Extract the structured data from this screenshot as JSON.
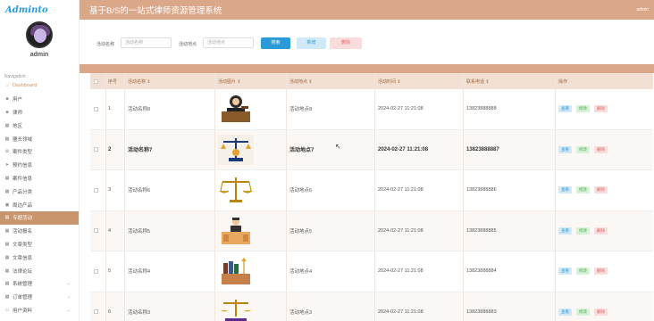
{
  "logo": "Adminto",
  "user": {
    "name": "admin"
  },
  "header": {
    "title": "基于B/S的一站式律师资源管理系统",
    "user": "admin"
  },
  "nav": {
    "title": "Navigation",
    "items": [
      {
        "label": "Dashboard",
        "icon": "home-icon"
      },
      {
        "label": "用户",
        "icon": "user-icon"
      },
      {
        "label": "律师",
        "icon": "briefcase-icon"
      },
      {
        "label": "地区",
        "icon": "grid-icon"
      },
      {
        "label": "擅长领域",
        "icon": "grid-icon"
      },
      {
        "label": "案件类型",
        "icon": "gear-icon"
      },
      {
        "label": "预约信息",
        "icon": "send-icon"
      },
      {
        "label": "案件信息",
        "icon": "grid-icon"
      },
      {
        "label": "产品分类",
        "icon": "grid-icon"
      },
      {
        "label": "周边产品",
        "icon": "box-icon"
      },
      {
        "label": "专题活动",
        "icon": "calendar-icon"
      },
      {
        "label": "活动报名",
        "icon": "grid-icon"
      },
      {
        "label": "文章类型",
        "icon": "grid-icon"
      },
      {
        "label": "文章信息",
        "icon": "grid-icon"
      },
      {
        "label": "法律论坛",
        "icon": "grid-icon"
      },
      {
        "label": "系统管理",
        "icon": "grid-icon"
      },
      {
        "label": "订单管理",
        "icon": "grid-icon"
      },
      {
        "label": "用户资料",
        "icon": "folder-icon"
      }
    ]
  },
  "search": {
    "name_label": "活动名称",
    "name_placeholder": "活动名称",
    "place_label": "活动地点",
    "place_placeholder": "活动地点",
    "search_btn": "搜索",
    "add_btn": "新增",
    "delete_btn": "删除"
  },
  "table": {
    "headers": [
      "序号",
      "活动名称 ⇕",
      "活动图片 ⇕",
      "活动地点 ⇕",
      "活动时间 ⇕",
      "联系电话 ⇕",
      "操作"
    ],
    "actions": {
      "view": "查看",
      "edit": "修改",
      "del": "删除"
    },
    "rows": [
      {
        "no": "1",
        "name": "活动名称8",
        "place": "活动地点8",
        "time": "2024-02-27 11:21:08",
        "phone": "13823888888",
        "image": "judge-gavel"
      },
      {
        "no": "2",
        "name": "活动名称7",
        "place": "活动地点7",
        "time": "2024-02-27 11:21:08",
        "phone": "13823888887",
        "image": "scales-justice"
      },
      {
        "no": "3",
        "name": "活动名称6",
        "place": "活动地点6",
        "time": "2024-02-27 11:21:08",
        "phone": "13823888886",
        "image": "gold-scales"
      },
      {
        "no": "4",
        "name": "活动名称5",
        "place": "活动地点5",
        "time": "2024-02-27 11:21:08",
        "phone": "13823888885",
        "image": "lawyer-desk"
      },
      {
        "no": "5",
        "name": "活动名称4",
        "place": "活动地点4",
        "time": "2024-02-27 11:21:08",
        "phone": "13823888884",
        "image": "law-books"
      },
      {
        "no": "6",
        "name": "活动名称3",
        "place": "活动地点3",
        "time": "2024-02-27 11:21:08",
        "phone": "13823888883",
        "image": "scales-books"
      }
    ]
  }
}
